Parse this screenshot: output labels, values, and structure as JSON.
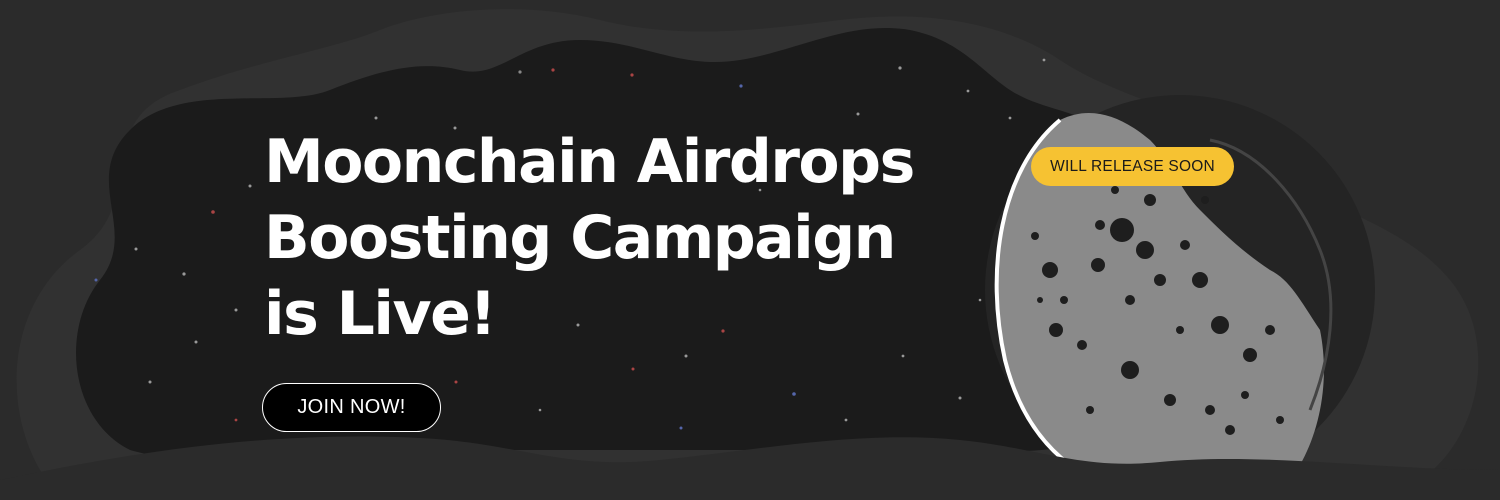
{
  "banner": {
    "headline_line1": "Moonchain Airdrops",
    "headline_line2": "Boosting Campaign",
    "headline_line3": "is Live!",
    "join_button_label": "JOIN NOW!",
    "badge_label": "WILL RELEASE SOON"
  },
  "colors": {
    "background": "#2b2b2b",
    "space": "#1a1a1a",
    "moon": "#8a8a8a",
    "badge": "#f6c232",
    "text": "#ffffff"
  },
  "icons": [
    "moon-illustration",
    "stars"
  ]
}
